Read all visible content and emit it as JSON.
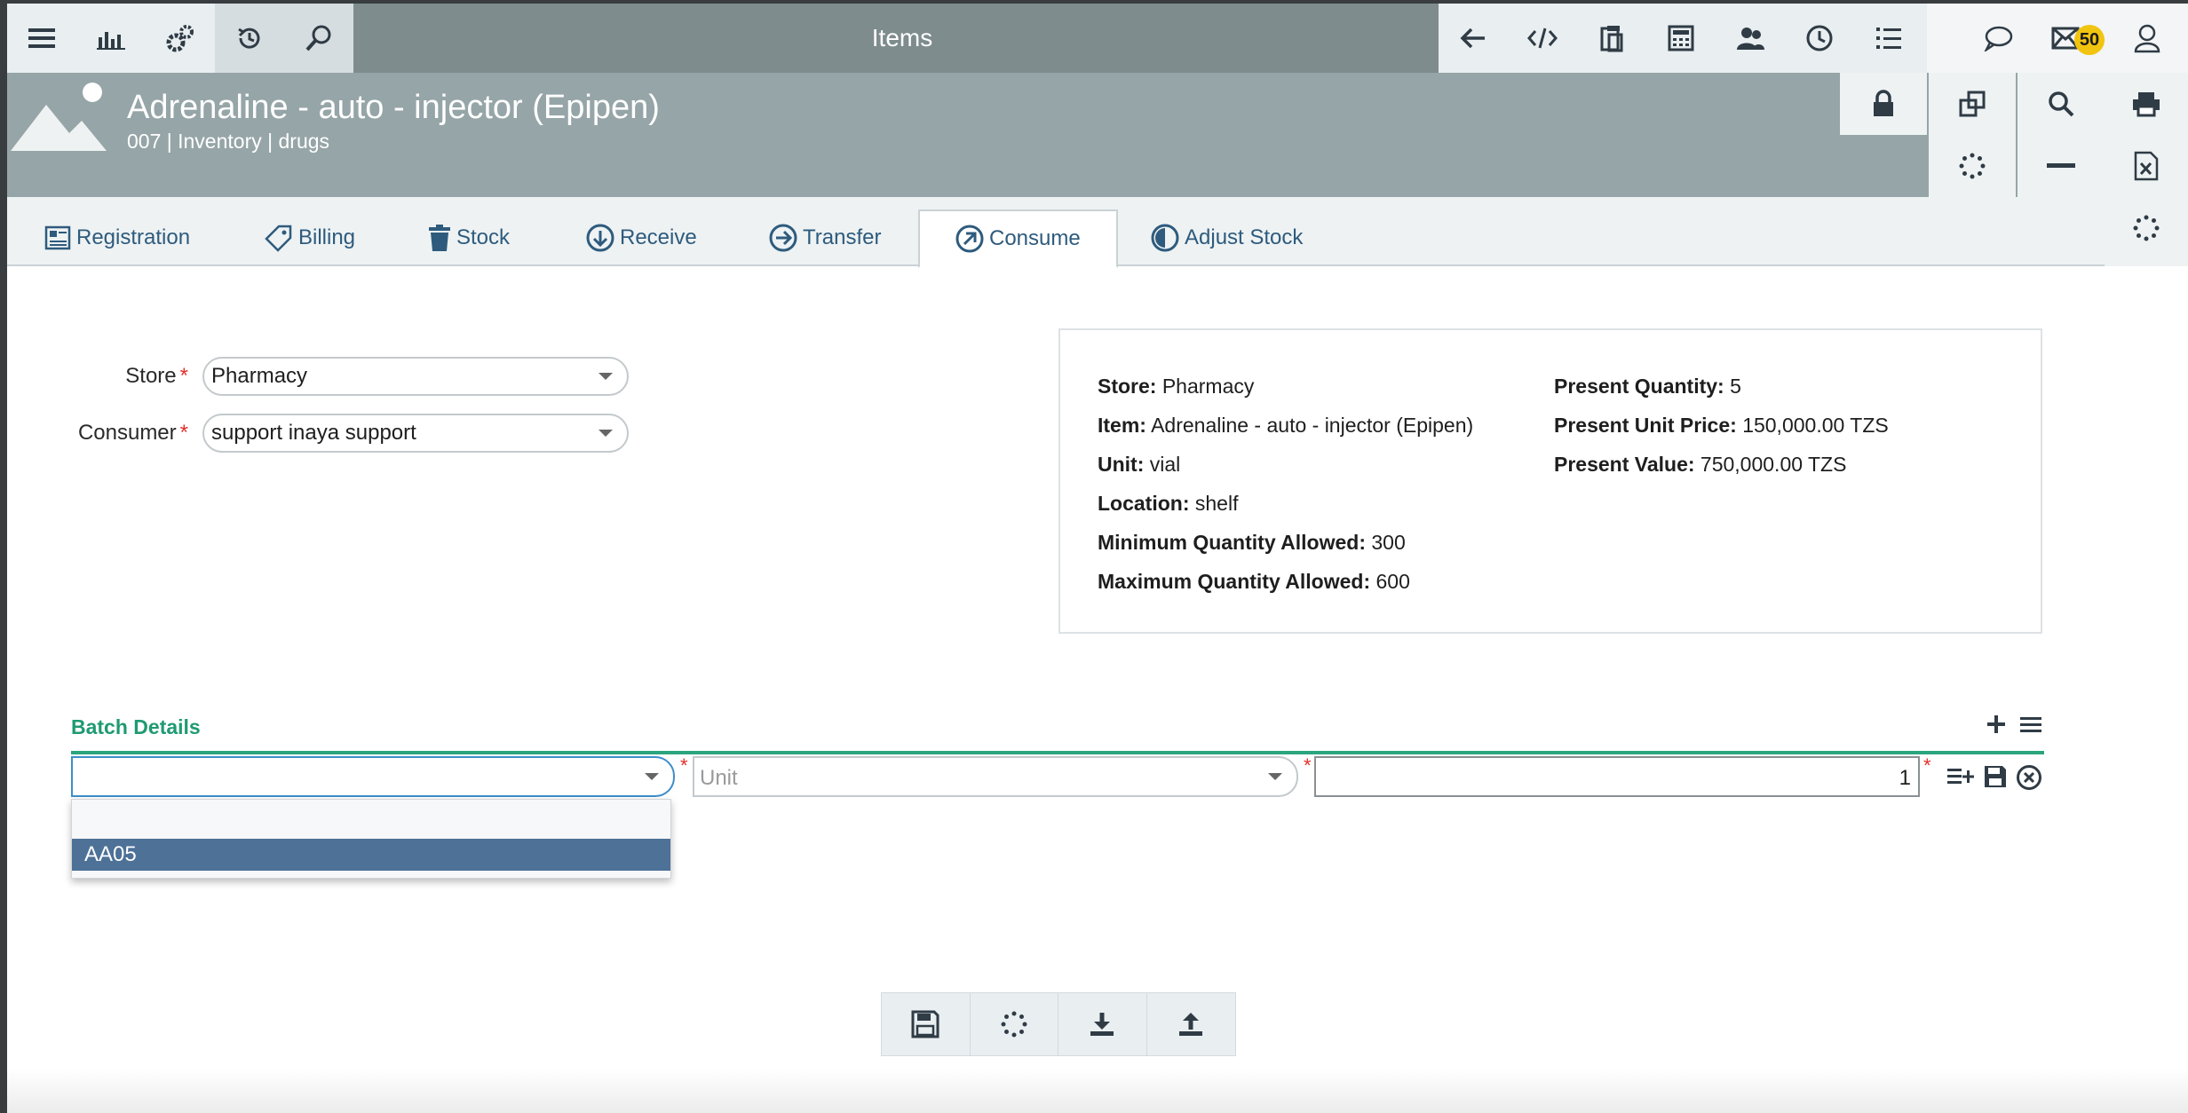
{
  "app": {
    "title": "Items",
    "notification_count": "50"
  },
  "item": {
    "title": "Adrenaline - auto - injector (Epipen)",
    "subtitle": "007 | Inventory | drugs"
  },
  "tabs": [
    {
      "label": "Registration",
      "icon": "registration-icon"
    },
    {
      "label": "Billing",
      "icon": "tag-icon"
    },
    {
      "label": "Stock",
      "icon": "trash-icon"
    },
    {
      "label": "Receive",
      "icon": "arrow-down-circle-icon"
    },
    {
      "label": "Transfer",
      "icon": "arrow-right-circle-icon"
    },
    {
      "label": "Consume",
      "icon": "arrow-up-right-circle-icon",
      "active": true
    },
    {
      "label": "Adjust Stock",
      "icon": "half-circle-icon"
    }
  ],
  "form": {
    "store_label": "Store",
    "store_value": "Pharmacy",
    "consumer_label": "Consumer",
    "consumer_value": "support inaya support",
    "required_mark": "*"
  },
  "info": {
    "store_label": "Store:",
    "store_value": "Pharmacy",
    "item_label": "Item:",
    "item_value": "Adrenaline - auto - injector (Epipen)",
    "unit_label": "Unit:",
    "unit_value": "vial",
    "location_label": "Location:",
    "location_value": "shelf",
    "min_label": "Minimum Quantity Allowed:",
    "min_value": "300",
    "max_label": "Maximum Quantity Allowed:",
    "max_value": "600",
    "present_qty_label": "Present Quantity:",
    "present_qty_value": "5",
    "present_price_label": "Present Unit Price:",
    "present_price_value": "150,000.00 TZS",
    "present_value_label": "Present Value:",
    "present_value_value": "750,000.00 TZS"
  },
  "batch": {
    "title": "Batch Details",
    "batch_value": "",
    "unit_placeholder": "Unit",
    "quantity_value": "1",
    "dropdown_options": [
      "",
      "AA05"
    ]
  },
  "colors": {
    "topbar": "#7e8c8d",
    "header": "#96a5a7",
    "accent_green": "#2aa57d",
    "tab_text": "#2e5b7d",
    "selected_option": "#4d7197",
    "badge": "#f1c40f"
  }
}
